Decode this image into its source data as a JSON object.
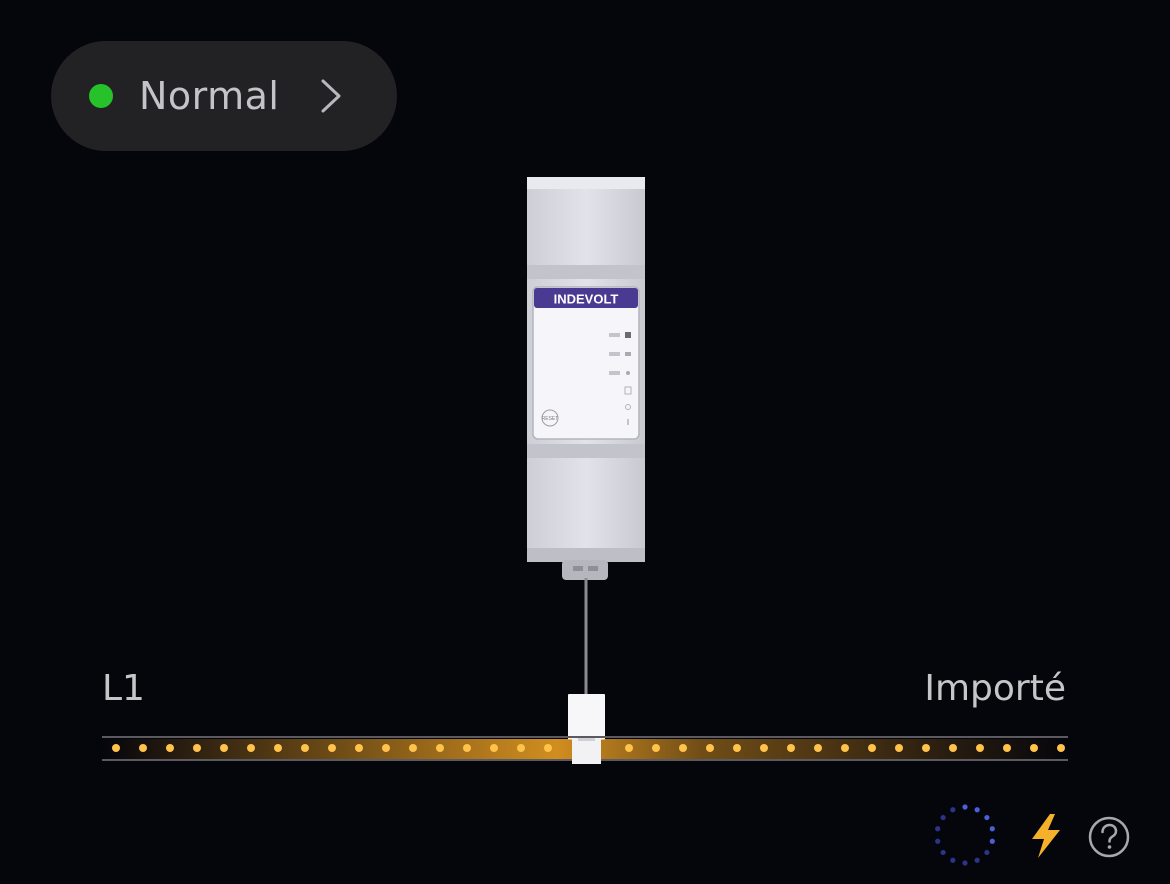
{
  "status": {
    "label": "Normal",
    "indicator_color": "#27c22a",
    "icon": "chevron-right-icon"
  },
  "device": {
    "brand": "INDEVOLT",
    "reset_label": "RESET",
    "brand_color": "#4a3a92"
  },
  "line": {
    "phase": "L1",
    "direction": "Importé",
    "flow_color": "#f5a623"
  },
  "bottom_icons": [
    "loading-icon",
    "lightning-icon",
    "help-icon"
  ]
}
